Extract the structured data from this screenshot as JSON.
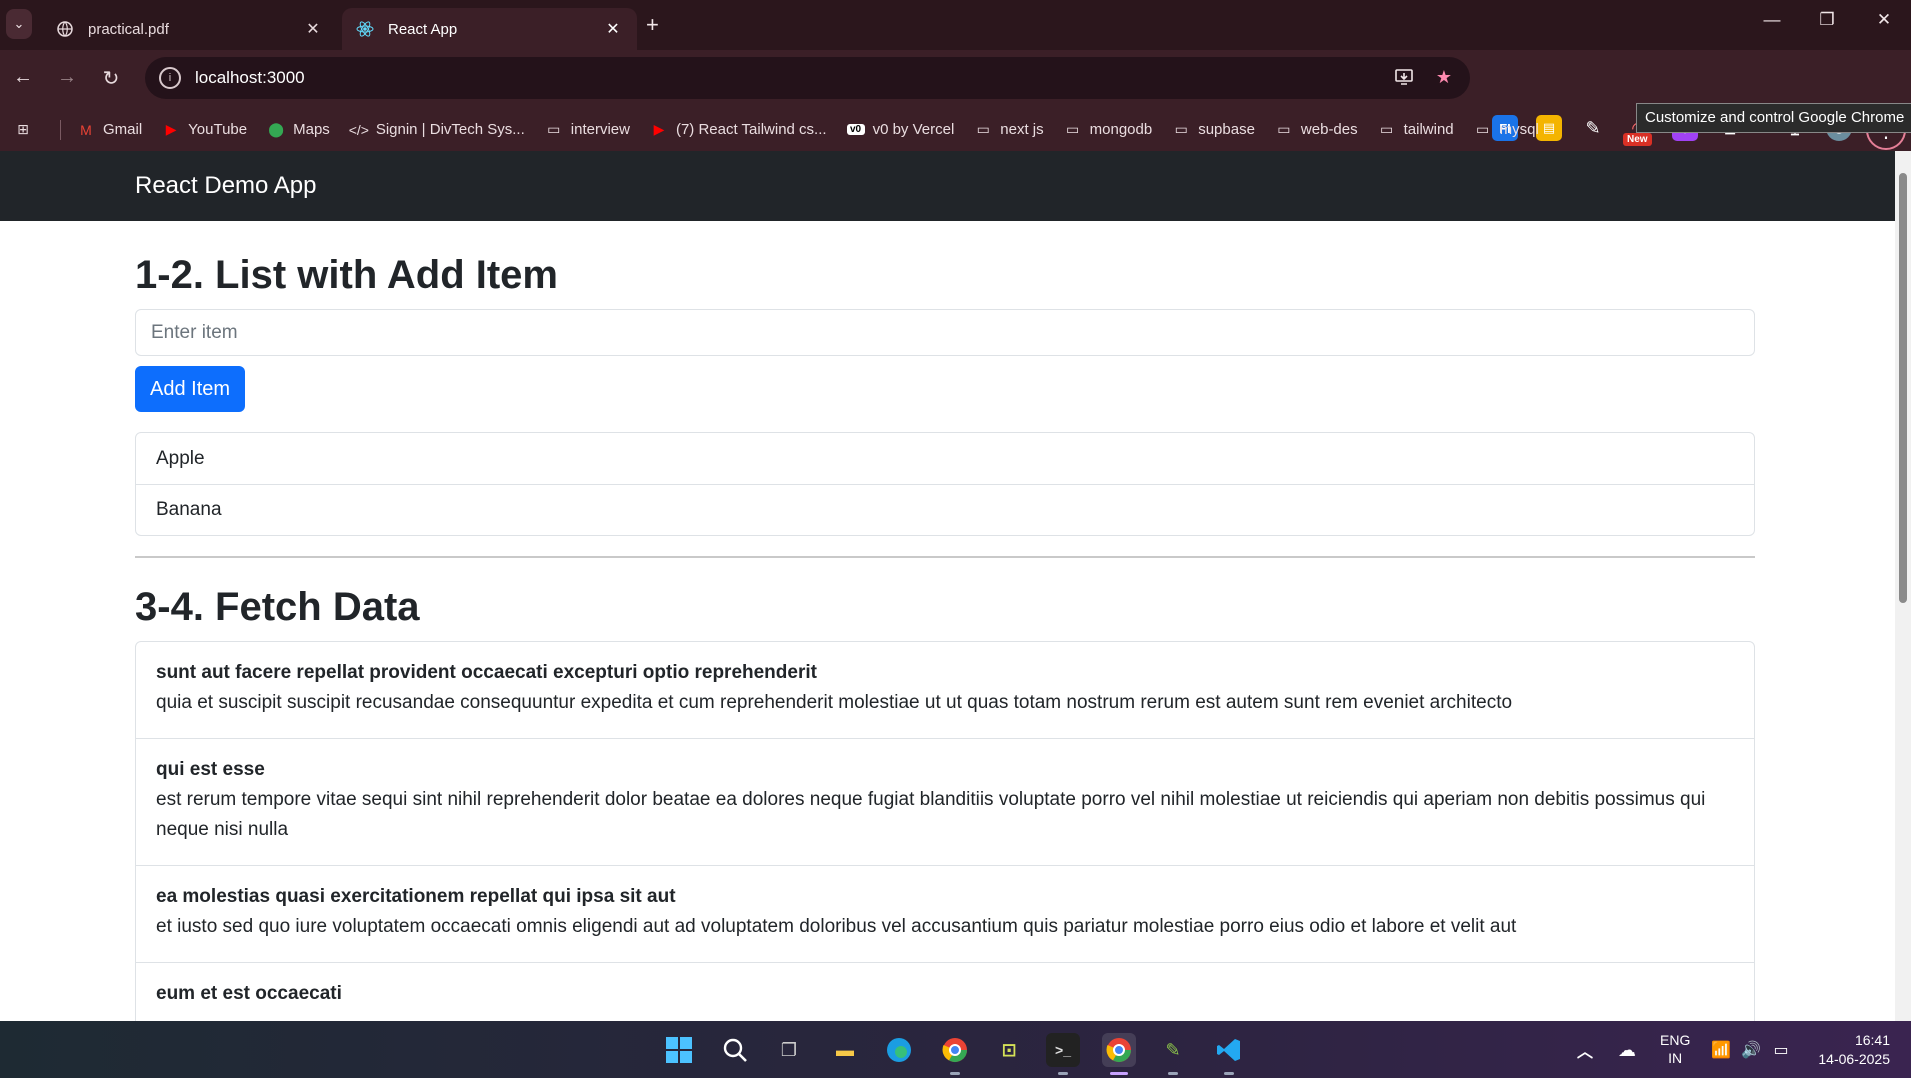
{
  "browser": {
    "tabs": [
      {
        "title": "practical.pdf",
        "icon": "globe-icon",
        "close": "✕"
      },
      {
        "title": "React App",
        "icon": "react-icon",
        "close": "✕"
      }
    ],
    "new_tab": "+",
    "window_controls": {
      "minimize": "—",
      "restore": "❐",
      "close": "✕"
    },
    "url": "localhost:3000",
    "bookmarks": [
      {
        "label": "Gmail",
        "icon": "gmail-icon"
      },
      {
        "label": "YouTube",
        "icon": "youtube-icon"
      },
      {
        "label": "Maps",
        "icon": "maps-icon"
      },
      {
        "label": "Signin | DivTech Sys...",
        "icon": "code-icon"
      },
      {
        "label": "interview",
        "icon": "folder-icon"
      },
      {
        "label": "(7) React Tailwind cs...",
        "icon": "youtube-icon"
      },
      {
        "label": "v0 by Vercel",
        "icon": "v0-icon"
      },
      {
        "label": "next js",
        "icon": "folder-icon"
      },
      {
        "label": "mongodb",
        "icon": "folder-icon"
      },
      {
        "label": "supbase",
        "icon": "folder-icon"
      },
      {
        "label": "web-des",
        "icon": "folder-icon"
      },
      {
        "label": "tailwind",
        "icon": "folder-icon"
      },
      {
        "label": "mysql",
        "icon": "folder-icon"
      }
    ],
    "new_badge": "New",
    "tooltip": "Customize and control Google Chrome"
  },
  "app": {
    "brand": "React Demo App",
    "list_section": {
      "heading": "1-2. List with Add Item",
      "input_placeholder": "Enter item",
      "add_button": "Add Item",
      "items": [
        "Apple",
        "Banana"
      ]
    },
    "fetch_section": {
      "heading": "3-4. Fetch Data",
      "posts": [
        {
          "title": "sunt aut facere repellat provident occaecati excepturi optio reprehenderit",
          "body": "quia et suscipit suscipit recusandae consequuntur expedita et cum reprehenderit molestiae ut ut quas totam nostrum rerum est autem sunt rem eveniet architecto"
        },
        {
          "title": "qui est esse",
          "body": "est rerum tempore vitae sequi sint nihil reprehenderit dolor beatae ea dolores neque fugiat blanditiis voluptate porro vel nihil molestiae ut reiciendis qui aperiam non debitis possimus qui neque nisi nulla"
        },
        {
          "title": "ea molestias quasi exercitationem repellat qui ipsa sit aut",
          "body": "et iusto sed quo iure voluptatem occaecati omnis eligendi aut ad voluptatem doloribus vel accusantium quis pariatur molestiae porro eius odio et labore et velit aut"
        },
        {
          "title": "eum et est occaecati",
          "body": ""
        }
      ]
    }
  },
  "taskbar": {
    "language": {
      "line1": "ENG",
      "line2": "IN"
    },
    "time": "16:41",
    "date": "14-06-2025"
  },
  "colors": {
    "chrome_bg": "#3b1f27",
    "tabstrip_bg": "#2b161c",
    "navbar_bg": "#212529",
    "primary": "#0d6efd",
    "border": "#dee2e6"
  }
}
